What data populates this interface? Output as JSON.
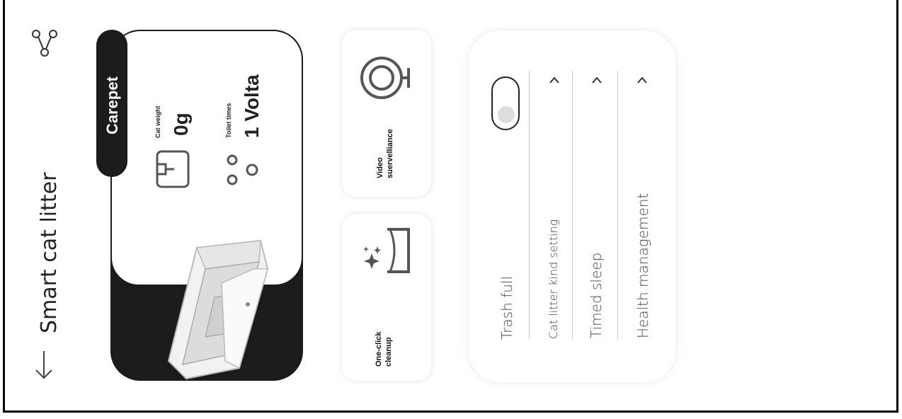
{
  "header": {
    "title": "Smart cat litter"
  },
  "device": {
    "brand": "Carepet",
    "cat_weight_label": "Cat weight",
    "cat_weight_value": "0g",
    "toilet_times_label": "Toilet times",
    "toilet_times_value": "1 Volta"
  },
  "actions": [
    {
      "label_line1": "Video",
      "label_line2": "suervelliance",
      "icon": "camera-icon"
    },
    {
      "label_line1": "One-click",
      "label_line2": "cleanup",
      "icon": "cleanup-icon"
    }
  ],
  "settings": {
    "trash_full": "Trash full",
    "trash_full_toggle": false,
    "items": [
      {
        "label": "Cat litter kind setting"
      },
      {
        "label": "Timed sleep"
      },
      {
        "label": "Health management"
      }
    ]
  },
  "icons": {
    "back": "arrow-down-icon",
    "share": "share-icon",
    "weight": "scale-icon",
    "toilet": "paw-icon"
  }
}
